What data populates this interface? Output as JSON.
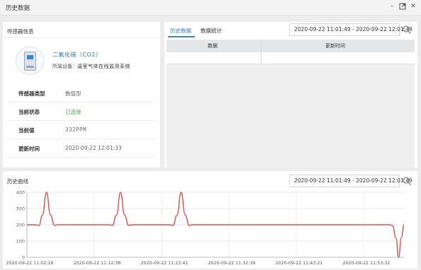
{
  "window": {
    "title": "历史数据",
    "controls": [
      "minimize-icon",
      "maximize-icon",
      "close-icon"
    ]
  },
  "sensor_panel": {
    "title": "传感器信息",
    "device_name": "二氧化碳（CO2）",
    "device_owner_label": "所属设备：",
    "device_owner_value": "温室气体在线监测系统",
    "rows": [
      {
        "label": "传感器类型",
        "value": "数值型"
      },
      {
        "label": "当前状态",
        "value": "已连接"
      },
      {
        "label": "当前值",
        "value": "332PPM"
      },
      {
        "label": "更新时间",
        "value": "2020-09-22 12:01:33"
      }
    ],
    "status_color": "#52b04f"
  },
  "history_panel": {
    "tabs": [
      {
        "label": "历史数据",
        "active": true
      },
      {
        "label": "数据统计",
        "active": false
      }
    ],
    "range": "2020-09-22 11:01:49 - 2020-09-22 12:01:49",
    "columns": [
      "数据",
      "更新时间"
    ],
    "accent": "#2f86d6"
  },
  "curve_panel": {
    "title": "历史曲线",
    "range": "2020-09-22 11:01:49 - 2020-09-22 12:01:49"
  },
  "chart_data": {
    "type": "line",
    "title": "",
    "xlabel": "",
    "ylabel": "",
    "ylim": [
      0,
      400
    ],
    "yticks": [
      0,
      100,
      200,
      300,
      400
    ],
    "grid": true,
    "color": "#d9534f",
    "x_tick_labels": [
      "2020-09-22 11:02:16",
      "2020-09-22 11:12:38",
      "2020-09-22 11:22:41",
      "2020-09-22 11:32:39",
      "2020-09-22 11:43:21",
      "2020-09-22 11:53:32"
    ],
    "x_tick_positions": [
      0,
      1,
      2,
      3,
      4,
      5
    ],
    "x_range": [
      0,
      5.6
    ],
    "points": [
      [
        0.0,
        200
      ],
      [
        0.12,
        200
      ],
      [
        0.18,
        196
      ],
      [
        0.23,
        260
      ],
      [
        0.29,
        400
      ],
      [
        0.35,
        260
      ],
      [
        0.41,
        196
      ],
      [
        0.46,
        200
      ],
      [
        0.58,
        200
      ],
      [
        0.7,
        200
      ],
      [
        0.82,
        200
      ],
      [
        0.93,
        200
      ],
      [
        1.05,
        200
      ],
      [
        1.16,
        200
      ],
      [
        1.22,
        200
      ],
      [
        1.27,
        196
      ],
      [
        1.33,
        260
      ],
      [
        1.39,
        400
      ],
      [
        1.45,
        260
      ],
      [
        1.51,
        196
      ],
      [
        1.56,
        200
      ],
      [
        1.68,
        200
      ],
      [
        1.8,
        200
      ],
      [
        1.92,
        200
      ],
      [
        2.03,
        200
      ],
      [
        2.12,
        200
      ],
      [
        2.17,
        196
      ],
      [
        2.23,
        260
      ],
      [
        2.29,
        400
      ],
      [
        2.35,
        260
      ],
      [
        2.41,
        196
      ],
      [
        2.46,
        200
      ],
      [
        2.58,
        200
      ],
      [
        2.7,
        200
      ],
      [
        2.82,
        200
      ],
      [
        2.93,
        200
      ],
      [
        3.05,
        200
      ],
      [
        3.16,
        200
      ],
      [
        3.28,
        200
      ],
      [
        3.4,
        200
      ],
      [
        3.51,
        200
      ],
      [
        3.63,
        200
      ],
      [
        3.75,
        200
      ],
      [
        3.86,
        200
      ],
      [
        3.98,
        200
      ],
      [
        4.1,
        200
      ],
      [
        4.21,
        200
      ],
      [
        4.33,
        200
      ],
      [
        4.45,
        200
      ],
      [
        4.56,
        200
      ],
      [
        4.68,
        200
      ],
      [
        4.8,
        200
      ],
      [
        4.91,
        200
      ],
      [
        5.03,
        200
      ],
      [
        5.15,
        200
      ],
      [
        5.26,
        200
      ],
      [
        5.38,
        200
      ],
      [
        5.43,
        195
      ],
      [
        5.48,
        120
      ],
      [
        5.52,
        0
      ],
      [
        5.56,
        120
      ],
      [
        5.6,
        200
      ]
    ]
  }
}
